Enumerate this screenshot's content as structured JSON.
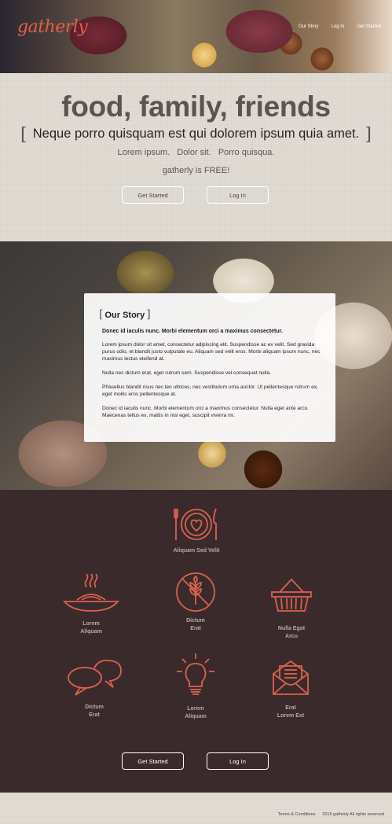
{
  "header": {
    "logo": "gatherly",
    "nav": [
      "Our Story",
      "Log In",
      "Get Started"
    ]
  },
  "hero": {
    "title": "food, family, friends",
    "tagline": "Neque porro quisquam est qui dolorem ipsum quia amet.",
    "subs": [
      "Lorem ipsum.",
      "Dolor sit.",
      "Porro quisqua."
    ],
    "free": "gatherly is FREE!",
    "get_started": "Get Started",
    "log_in": "Log In"
  },
  "story": {
    "heading": "Our Story",
    "lead": "Donec id iaculis nunc. Morbi elementum orci a maximus consectetur.",
    "paragraphs": [
      "Lorem ipsum dolor sit amet, consectetur adipiscing elit. Suspendisse ac ex velit. Sed gravida purus odio, et blandit justo vulputate eu. Aliquam sed velit eros. Morbi aliquam ipsum nunc, nec maximus lectus eleifend at.",
      "Nulla nec dictum erat, eget rutrum sem. Suspendisse vel consequat nulla.",
      "Phasellus blandit risus nec leo ultrices, nec vestibulum urna auctor. Ut pellentesque rutrum ex, eget mollis eros pellentesque at.",
      "Donec id iaculis nunc. Morbi elementum orci a maximus consectetur. Nulla eget ante arcu. Maecenas tellus ex, mattis in nisl eget, suscipit viverra mi."
    ]
  },
  "features": {
    "top": {
      "label": "Aliquam Sed Velit",
      "icon": "plate-heart-icon"
    },
    "items": [
      {
        "line1": "Lorem",
        "line2": "Aliquam",
        "icon": "noodle-bowl-icon"
      },
      {
        "line1": "Dictum",
        "line2": "Erat",
        "icon": "no-wheat-icon"
      },
      {
        "line1": "Nulla Egat",
        "line2": "Arcu",
        "icon": "basket-icon"
      },
      {
        "line1": "Dictum",
        "line2": "Erat",
        "icon": "chat-bubbles-icon"
      },
      {
        "line1": "Lorem",
        "line2": "Aliquam",
        "icon": "lightbulb-icon"
      },
      {
        "line1": "Erat",
        "line2": "Lorem Est",
        "icon": "envelope-icon"
      }
    ],
    "get_started": "Get Started",
    "log_in": "Log In",
    "icon_color": "#d9624f"
  },
  "footer": {
    "terms": "Terms & Conditions",
    "copyright": "2016 gatherly All rights reserved"
  }
}
